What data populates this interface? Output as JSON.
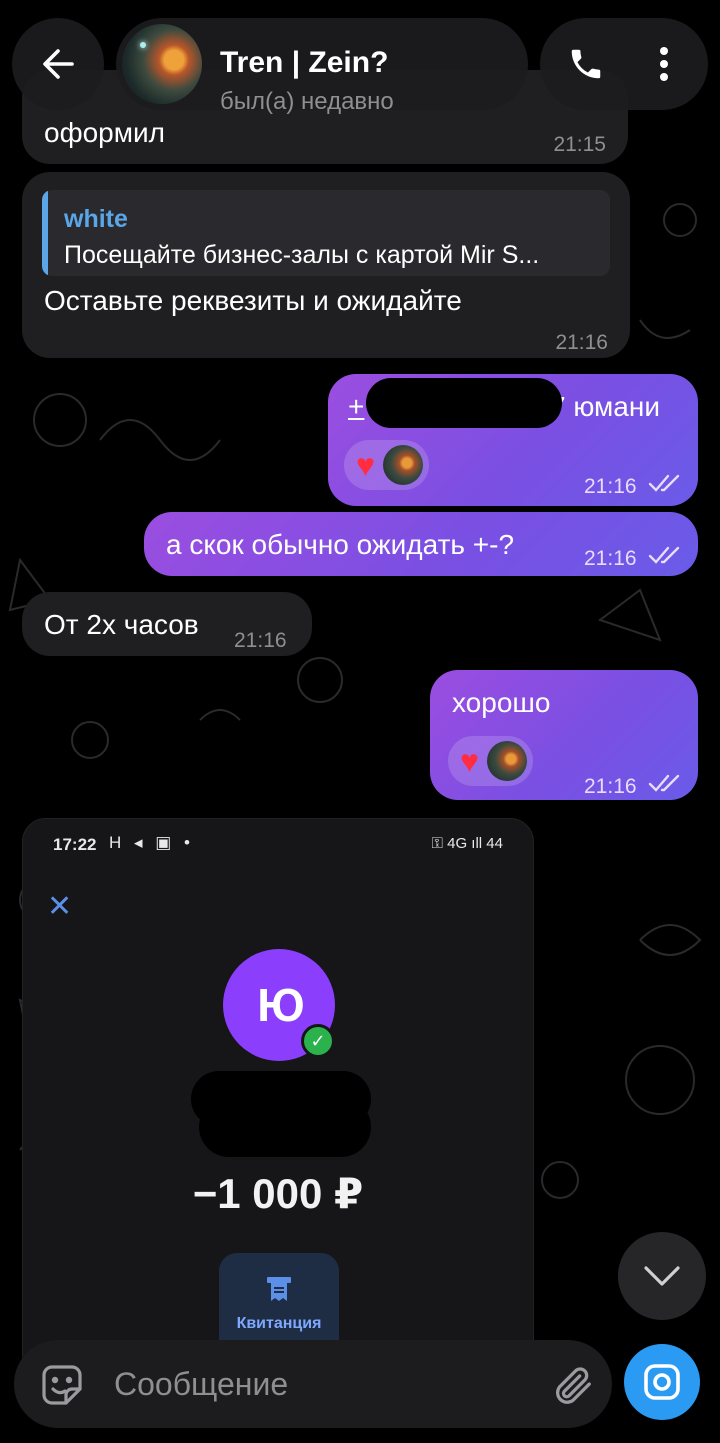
{
  "header": {
    "contact_name": "Tren | Zein?",
    "contact_status": "был(а) недавно"
  },
  "messages": {
    "m1": {
      "text": "оформил",
      "time": "21:15"
    },
    "m2": {
      "reply_name": "white",
      "reply_text": "Посещайте бизнес-залы с картой Mir S...",
      "text": "Оставьте реквезиты и ожидайте",
      "time": "21:16"
    },
    "m3": {
      "text_start": "+",
      "text_end": "7 юмани",
      "time": "21:16",
      "reaction": "❤️"
    },
    "m4": {
      "text": "а скок обычно ожидать +-?",
      "time": "21:16"
    },
    "m5": {
      "text": "От 2х часов",
      "time": "21:16"
    },
    "m6": {
      "text": "хорошо",
      "time": "21:16",
      "reaction": "❤️"
    }
  },
  "media": {
    "status_time": "17:22",
    "status_icons": "H ◂ ▣ •",
    "status_right": "⚿ 4G ıll 44",
    "logo_text": "Ю",
    "amount": "−1 000 ₽",
    "receipt_label": "Квитанция"
  },
  "input": {
    "placeholder": "Сообщение"
  },
  "colors": {
    "outgoing_start": "#9b4ee0",
    "outgoing_end": "#6a5be8",
    "incoming": "#1f1f21",
    "accent": "#2a9af2",
    "reply_accent": "#5aa6e6"
  },
  "icons": {
    "back": "arrow-left-icon",
    "call": "phone-icon",
    "menu": "more-vertical-icon",
    "sticker": "sticker-icon",
    "attach": "paperclip-icon",
    "camera": "camera-icon",
    "scroll": "chevron-down-icon"
  }
}
